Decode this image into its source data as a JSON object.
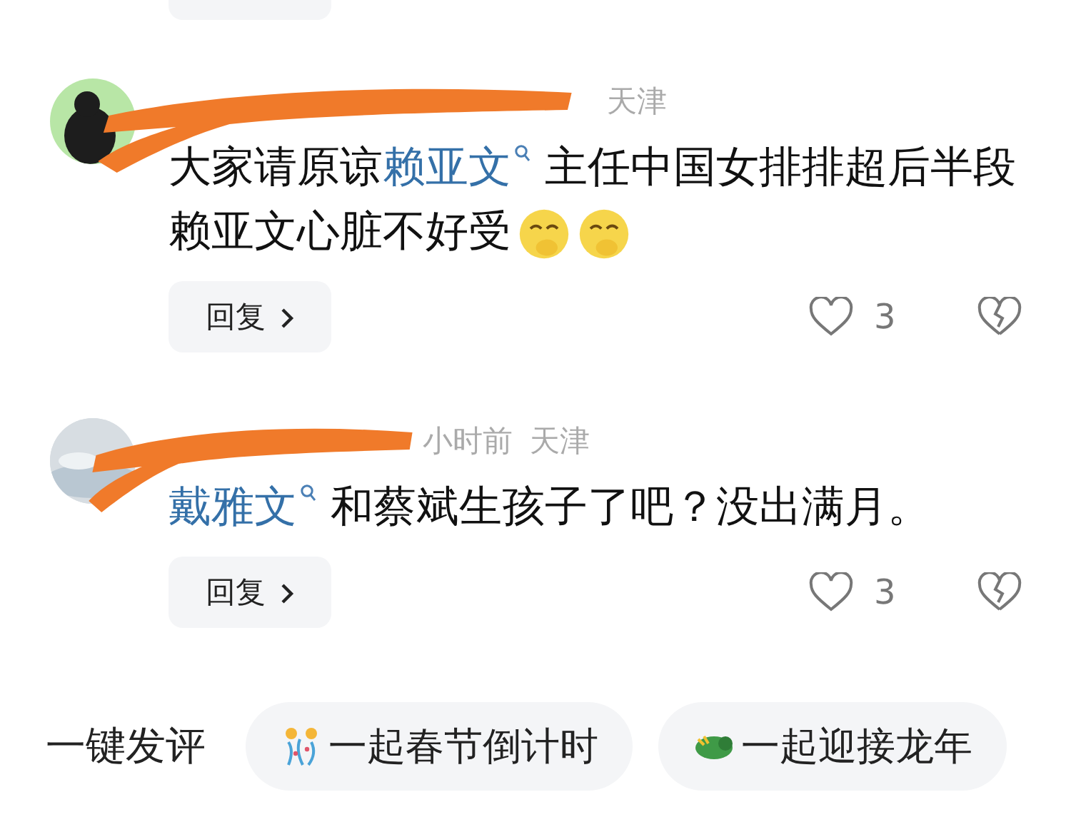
{
  "comments": [
    {
      "redacted": true,
      "location": "天津",
      "body": [
        {
          "kind": "text",
          "text": "大家请原谅"
        },
        {
          "kind": "link",
          "text": "赖亚文"
        },
        {
          "kind": "text",
          "text": " 主任中国女排排超后半段赖亚文心脏不好受"
        },
        {
          "kind": "emoji"
        },
        {
          "kind": "emoji"
        }
      ],
      "reply": "回复",
      "likes": "3"
    },
    {
      "redacted": true,
      "time": "小时前",
      "location": "天津",
      "body": [
        {
          "kind": "link",
          "text": "戴雅文"
        },
        {
          "kind": "text",
          "text": " 和蔡斌生孩子了吧？没出满月。"
        }
      ],
      "reply": "回复",
      "likes": "3"
    }
  ],
  "quick_comment": {
    "label": "一键发评",
    "chips": [
      {
        "text": "一起春节倒计时"
      },
      {
        "text": "一起迎接龙年"
      }
    ]
  }
}
